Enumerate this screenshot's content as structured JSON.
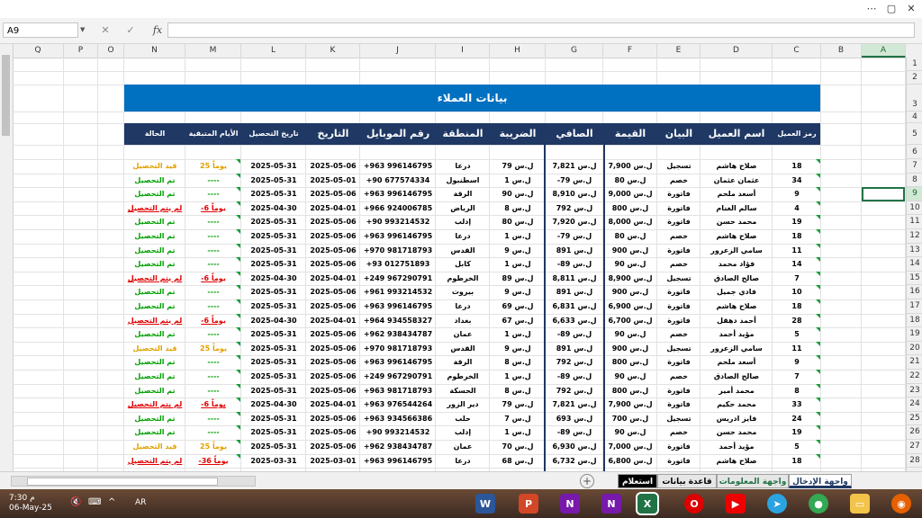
{
  "window": {
    "opts_icon": "more-options-icon",
    "restore_icon": "restore-window-icon",
    "close_icon": "close-window-icon"
  },
  "formula_bar": {
    "name_box": "A9",
    "cancel": "✕",
    "confirm": "✓",
    "fx": "fx",
    "formula": ""
  },
  "columns": [
    "Q",
    "P",
    "O",
    "N",
    "M",
    "L",
    "K",
    "J",
    "I",
    "H",
    "G",
    "F",
    "E",
    "D",
    "C",
    "B",
    "A"
  ],
  "rows": [
    "1",
    "2",
    "3",
    "4",
    "5",
    "6",
    "7",
    "8",
    "9",
    "10",
    "11",
    "12",
    "13",
    "14",
    "15",
    "16",
    "17",
    "18",
    "19",
    "20",
    "21",
    "22",
    "23",
    "24",
    "25",
    "26",
    "27",
    "28"
  ],
  "sheet": {
    "title": "بيانات العملاء",
    "headers": {
      "code": "رمز العميل",
      "name": "اسم العميل",
      "statement": "البيان",
      "value": "القيمة",
      "net": "الصافي",
      "tax": "الضريبة",
      "region": "المنطقة",
      "mobile": "رقم الموبايل",
      "date": "التاريخ",
      "due": "تاريخ التحصيل",
      "days": "الأيام المتبقية",
      "status": "الحالة"
    },
    "records": [
      {
        "code": "18",
        "name": "صلاح هاشم",
        "statement": "تسجيل",
        "value": "7,900 ل.س",
        "net": "7,821 ل.س",
        "tax": "79 ل.س",
        "region": "درعا",
        "mobile": "+963 996146795",
        "date": "2025-05-06",
        "due": "2025-05-31",
        "days": "25 يوماً",
        "status": "قيد التحصيل"
      },
      {
        "code": "34",
        "name": "عثمان عثمان",
        "statement": "خصم",
        "value": "80 ل.س",
        "net": "-79 ل.س",
        "tax": "1 ل.س",
        "region": "اسطنبول",
        "mobile": "+90 677574334",
        "date": "2025-05-01",
        "due": "2025-05-31",
        "days": "----",
        "status": "تم التحصيل"
      },
      {
        "code": "9",
        "name": "أسعد ملحم",
        "statement": "فاتورة",
        "value": "9,000 ل.س",
        "net": "8,910 ل.س",
        "tax": "90 ل.س",
        "region": "الرقة",
        "mobile": "+963 996146795",
        "date": "2025-05-06",
        "due": "2025-05-31",
        "days": "----",
        "status": "تم التحصيل"
      },
      {
        "code": "4",
        "name": "سالم الغنام",
        "statement": "فاتورة",
        "value": "800 ل.س",
        "net": "792 ل.س",
        "tax": "8 ل.س",
        "region": "الرياض",
        "mobile": "+966 924006785",
        "date": "2025-04-01",
        "due": "2025-04-30",
        "days": "-6 يوماً",
        "status": "لم يتم التحصيل"
      },
      {
        "code": "19",
        "name": "محمد حسن",
        "statement": "فاتورة",
        "value": "8,000 ل.س",
        "net": "7,920 ل.س",
        "tax": "80 ل.س",
        "region": "إدلب",
        "mobile": "+90 993214532",
        "date": "2025-05-06",
        "due": "2025-05-31",
        "days": "----",
        "status": "تم التحصيل"
      },
      {
        "code": "18",
        "name": "صلاح هاشم",
        "statement": "خصم",
        "value": "80 ل.س",
        "net": "-79 ل.س",
        "tax": "1 ل.س",
        "region": "درعا",
        "mobile": "+963 996146795",
        "date": "2025-05-06",
        "due": "2025-05-31",
        "days": "----",
        "status": "تم التحصيل"
      },
      {
        "code": "11",
        "name": "سامي الزعرور",
        "statement": "فاتورة",
        "value": "900 ل.س",
        "net": "891 ل.س",
        "tax": "9 ل.س",
        "region": "القدس",
        "mobile": "+970 981718793",
        "date": "2025-05-06",
        "due": "2025-05-31",
        "days": "----",
        "status": "تم التحصيل"
      },
      {
        "code": "14",
        "name": "فؤاد محمد",
        "statement": "خصم",
        "value": "90 ل.س",
        "net": "-89 ل.س",
        "tax": "1 ل.س",
        "region": "كابل",
        "mobile": "+93 012751893",
        "date": "2025-05-06",
        "due": "2025-05-31",
        "days": "----",
        "status": "تم التحصيل"
      },
      {
        "code": "7",
        "name": "صالح الصادق",
        "statement": "تسجيل",
        "value": "8,900 ل.س",
        "net": "8,811 ل.س",
        "tax": "89 ل.س",
        "region": "الخرطوم",
        "mobile": "+249 967290791",
        "date": "2025-04-01",
        "due": "2025-04-30",
        "days": "-6 يوماً",
        "status": "لم يتم التحصيل"
      },
      {
        "code": "10",
        "name": "فادي جميل",
        "statement": "فاتورة",
        "value": "900 ل.س",
        "net": "891 ل.س",
        "tax": "9 ل.س",
        "region": "بيروت",
        "mobile": "+961 993214532",
        "date": "2025-05-06",
        "due": "2025-05-31",
        "days": "----",
        "status": "تم التحصيل"
      },
      {
        "code": "18",
        "name": "صلاح هاشم",
        "statement": "فاتورة",
        "value": "6,900 ل.س",
        "net": "6,831 ل.س",
        "tax": "69 ل.س",
        "region": "درعا",
        "mobile": "+963 996146795",
        "date": "2025-05-06",
        "due": "2025-05-31",
        "days": "----",
        "status": "تم التحصيل"
      },
      {
        "code": "28",
        "name": "أحمد دهقل",
        "statement": "فاتورة",
        "value": "6,700 ل.س",
        "net": "6,633 ل.س",
        "tax": "67 ل.س",
        "region": "بغداد",
        "mobile": "+964 934558327",
        "date": "2025-04-01",
        "due": "2025-04-30",
        "days": "-6 يوماً",
        "status": "لم يتم التحصيل"
      },
      {
        "code": "5",
        "name": "مؤيد أحمد",
        "statement": "خصم",
        "value": "90 ل.س",
        "net": "-89 ل.س",
        "tax": "1 ل.س",
        "region": "عمان",
        "mobile": "+962 938434787",
        "date": "2025-05-06",
        "due": "2025-05-31",
        "days": "----",
        "status": "تم التحصيل"
      },
      {
        "code": "11",
        "name": "سامي الزعرور",
        "statement": "تسجيل",
        "value": "900 ل.س",
        "net": "891 ل.س",
        "tax": "9 ل.س",
        "region": "القدس",
        "mobile": "+970 981718793",
        "date": "2025-05-06",
        "due": "2025-05-31",
        "days": "25 يوماً",
        "status": "قيد التحصيل"
      },
      {
        "code": "9",
        "name": "أسعد ملحم",
        "statement": "فاتورة",
        "value": "800 ل.س",
        "net": "792 ل.س",
        "tax": "8 ل.س",
        "region": "الرقة",
        "mobile": "+963 996146795",
        "date": "2025-05-06",
        "due": "2025-05-31",
        "days": "----",
        "status": "تم التحصيل"
      },
      {
        "code": "7",
        "name": "صالح الصادق",
        "statement": "خصم",
        "value": "90 ل.س",
        "net": "-89 ل.س",
        "tax": "1 ل.س",
        "region": "الخرطوم",
        "mobile": "+249 967290791",
        "date": "2025-05-06",
        "due": "2025-05-31",
        "days": "----",
        "status": "تم التحصيل"
      },
      {
        "code": "8",
        "name": "محمد أمير",
        "statement": "فاتورة",
        "value": "800 ل.س",
        "net": "792 ل.س",
        "tax": "8 ل.س",
        "region": "الحسكة",
        "mobile": "+963 981718793",
        "date": "2025-05-06",
        "due": "2025-05-31",
        "days": "----",
        "status": "تم التحصيل"
      },
      {
        "code": "33",
        "name": "محمد حكيم",
        "statement": "فاتورة",
        "value": "7,900 ل.س",
        "net": "7,821 ل.س",
        "tax": "79 ل.س",
        "region": "دير الزور",
        "mobile": "+963 976544264",
        "date": "2025-04-01",
        "due": "2025-04-30",
        "days": "-6 يوماً",
        "status": "لم يتم التحصيل"
      },
      {
        "code": "24",
        "name": "فايز ادريس",
        "statement": "تسجيل",
        "value": "700 ل.س",
        "net": "693 ل.س",
        "tax": "7 ل.س",
        "region": "حلب",
        "mobile": "+963 934566386",
        "date": "2025-05-06",
        "due": "2025-05-31",
        "days": "----",
        "status": "تم التحصيل"
      },
      {
        "code": "19",
        "name": "محمد حسن",
        "statement": "خصم",
        "value": "90 ل.س",
        "net": "-89 ل.س",
        "tax": "1 ل.س",
        "region": "إدلب",
        "mobile": "+90 993214532",
        "date": "2025-05-06",
        "due": "2025-05-31",
        "days": "----",
        "status": "تم التحصيل"
      },
      {
        "code": "5",
        "name": "مؤيد أحمد",
        "statement": "فاتورة",
        "value": "7,000 ل.س",
        "net": "6,930 ل.س",
        "tax": "70 ل.س",
        "region": "عمان",
        "mobile": "+962 938434787",
        "date": "2025-05-06",
        "due": "2025-05-31",
        "days": "25 يوماً",
        "status": "قيد التحصيل"
      },
      {
        "code": "18",
        "name": "صلاح هاشم",
        "statement": "فاتورة",
        "value": "6,800 ل.س",
        "net": "6,732 ل.س",
        "tax": "68 ل.س",
        "region": "درعا",
        "mobile": "+963 996146795",
        "date": "2025-03-01",
        "due": "2025-03-31",
        "days": "-36 يوماً",
        "status": "لم يتم التحصيل"
      }
    ]
  },
  "tabs": [
    {
      "label": "واجهة الإدخال",
      "active": true
    },
    {
      "label": "واجهة المعلومات",
      "active": false
    },
    {
      "label": "قاعدة بيانات",
      "active": false
    },
    {
      "label": "استعلام",
      "active": false
    }
  ],
  "tab_add": "+",
  "taskbar": {
    "time": "7:30 م",
    "date": "06-May-25",
    "lang": "AR",
    "apps": [
      "word-icon",
      "powerpoint-icon",
      "onenote-icon",
      "onenote-icon",
      "excel-icon",
      "opera-icon",
      "youtube-icon",
      "telegram-icon",
      "chrome-icon",
      "file-explorer-icon",
      "firefox-icon"
    ]
  },
  "colors": {
    "title_band": "#0070c0",
    "header_band": "#1f3864",
    "collected": "#00a000",
    "not_collected": "#e00000",
    "pending": "#e0a000",
    "excel_green": "#217346"
  }
}
